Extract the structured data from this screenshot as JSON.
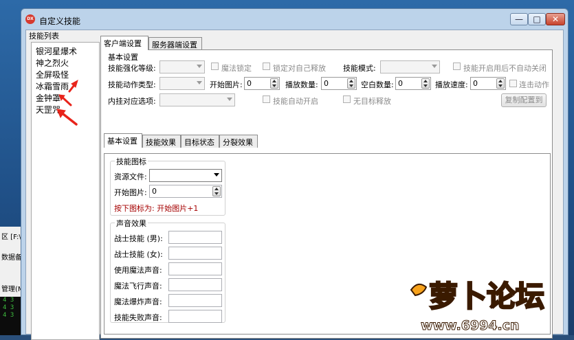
{
  "window": {
    "title": "自定义技能",
    "app_icon_text": "DX",
    "controls": {
      "minimize": "—",
      "maximize": "□",
      "close": "✕"
    }
  },
  "background": {
    "left_rows": [
      "区 [F:\\",
      "数据备",
      "管理(M"
    ],
    "console_lines": [
      "4 3",
      "4 3",
      "4 3"
    ]
  },
  "skill_list": {
    "title": "技能列表",
    "items": [
      "银河星爆术",
      "神之烈火",
      "全屏吸怪",
      "冰霜雪雨",
      "金钟罩",
      "天罡咒"
    ]
  },
  "top_tabs": [
    "客户端设置",
    "服务器端设置"
  ],
  "basic_settings": {
    "title": "基本设置",
    "enhance_level_label": "技能强化等级:",
    "magic_lock_label": "魔法锁定",
    "lock_self_label": "锁定对自己释放",
    "skill_mode_label": "技能模式:",
    "auto_close_label": "技能开启用后不自动关闭",
    "action_type_label": "技能动作类型:",
    "start_image_label": "开始图片:",
    "start_image_value": "0",
    "play_count_label": "播放数量:",
    "play_count_value": "0",
    "blank_count_label": "空白数量:",
    "blank_count_value": "0",
    "play_speed_label": "播放速度:",
    "play_speed_value": "0",
    "combo_action_label": "连击动作",
    "plugin_option_label": "内挂对应选项:",
    "auto_start_label": "技能自动开启",
    "no_target_label": "无目标释放",
    "copy_button": "复制配置到"
  },
  "sub_tabs": [
    "基本设置",
    "技能效果",
    "目标状态",
    "分裂效果"
  ],
  "skill_icon": {
    "title": "技能图标",
    "resource_file_label": "资源文件:",
    "start_image_label": "开始图片:",
    "start_image_value": "0",
    "hint": "按下图标为: 开始图片+1"
  },
  "sound_effects": {
    "title": "声音效果",
    "fields": [
      "战士技能 (男):",
      "战士技能 (女):",
      "使用魔法声音:",
      "魔法飞行声音:",
      "魔法爆炸声音:",
      "技能失败声音:"
    ]
  },
  "watermark": {
    "brand": "萝卜论坛",
    "url": "www.6994.cn"
  },
  "colors": {
    "hint_red": "#a50000",
    "arrow_red": "#e8241b"
  }
}
